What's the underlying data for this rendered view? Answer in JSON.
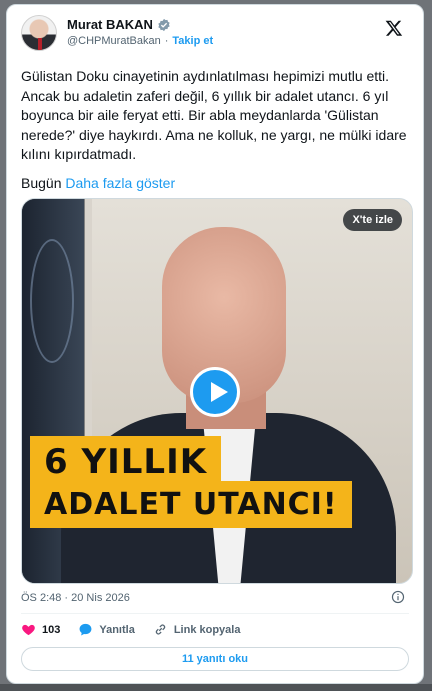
{
  "author": {
    "name": "Murat BAKAN",
    "handle": "@CHPMuratBakan",
    "separator": "·",
    "follow_label": "Takip et"
  },
  "tweet": {
    "text": "Gülistan Doku cinayetinin aydınlatılması hepimizi mutlu etti. Ancak bu adaletin zaferi değil, 6 yıllık bir adalet utancı. 6 yıl boyunca bir aile feryat etti. Bir abla meydanlarda 'Gülistan nerede?' diye haykırdı. Ama ne kolluk, ne yargı, ne mülki idare kılını kıpırdatmadı.",
    "when": "Bugün",
    "show_more": "Daha fazla göster"
  },
  "media": {
    "watch_label": "X'te izle",
    "banner_line1": "6 YILLIK",
    "banner_line2": "ADALET UTANCI!"
  },
  "meta": {
    "timestamp": "ÖS 2:48 · 20 Nis 2026"
  },
  "actions": {
    "like_count": "103",
    "reply_label": "Yanıtla",
    "copy_link_label": "Link kopyala"
  },
  "replies_button": "11 yanıtı oku",
  "colors": {
    "accent": "#1d9bf0",
    "like": "#f91880",
    "banner": "#f4b41a"
  },
  "icons": [
    "verified-badge-icon",
    "x-logo-icon",
    "play-icon",
    "info-icon",
    "heart-icon",
    "reply-icon",
    "link-icon"
  ]
}
